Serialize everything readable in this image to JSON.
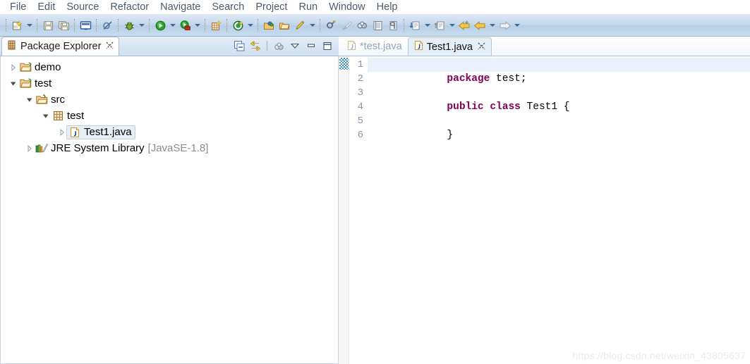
{
  "menubar": {
    "items": [
      {
        "label": "File"
      },
      {
        "label": "Edit"
      },
      {
        "label": "Source"
      },
      {
        "label": "Refactor"
      },
      {
        "label": "Navigate"
      },
      {
        "label": "Search"
      },
      {
        "label": "Project"
      },
      {
        "label": "Run"
      },
      {
        "label": "Window"
      },
      {
        "label": "Help"
      }
    ]
  },
  "toolbar": {
    "buttons": [
      {
        "name": "new-icon",
        "tooltip": "New"
      },
      {
        "name": "new-dropdown-arrow-icon",
        "tooltip": "New menu"
      },
      {
        "name": "save-icon",
        "tooltip": "Save"
      },
      {
        "name": "save-all-icon",
        "tooltip": "Save All"
      },
      {
        "name": "console-icon",
        "tooltip": "Open Console"
      },
      {
        "name": "skip-breakpoints-icon",
        "tooltip": "Skip All Breakpoints"
      },
      {
        "name": "debug-bug-icon",
        "tooltip": "Debug"
      },
      {
        "name": "debug-dropdown-arrow-icon",
        "tooltip": "Debug menu"
      },
      {
        "name": "run-play-icon",
        "tooltip": "Run"
      },
      {
        "name": "run-dropdown-arrow-icon",
        "tooltip": "Run menu"
      },
      {
        "name": "external-tools-icon",
        "tooltip": "External Tools"
      },
      {
        "name": "external-tools-dropdown-arrow-icon",
        "tooltip": "External Tools menu"
      },
      {
        "name": "new-java-project-icon",
        "tooltip": "New Java Project"
      },
      {
        "name": "new-java-class-icon",
        "tooltip": "New Java Class"
      },
      {
        "name": "new-class-dropdown-arrow-icon",
        "tooltip": "New Java Class menu"
      },
      {
        "name": "open-type-icon",
        "tooltip": "Open Type"
      },
      {
        "name": "open-task-icon",
        "tooltip": "Open Task"
      },
      {
        "name": "toggle-mark-occurrences-icon",
        "tooltip": "Toggle Mark Occurrences"
      },
      {
        "name": "mark-occurrences-dropdown-arrow-icon",
        "tooltip": "Mark Occurrences menu"
      },
      {
        "name": "new-task-icon",
        "tooltip": "New Task"
      },
      {
        "name": "clear-icon",
        "tooltip": "Clear"
      },
      {
        "name": "task-repository-icon",
        "tooltip": "Task Repositories"
      },
      {
        "name": "outline-icon",
        "tooltip": "Outline"
      },
      {
        "name": "show-whitespace-icon",
        "tooltip": "Show Whitespace Characters"
      },
      {
        "name": "pilcrow-icon",
        "tooltip": "Show Print Margin"
      },
      {
        "name": "next-annotation-icon",
        "tooltip": "Next Annotation"
      },
      {
        "name": "next-annotation-dropdown-arrow-icon",
        "tooltip": "Next Annotation menu"
      },
      {
        "name": "previous-annotation-icon",
        "tooltip": "Previous Annotation"
      },
      {
        "name": "previous-annotation-dropdown-arrow-icon",
        "tooltip": "Previous Annotation menu"
      },
      {
        "name": "back-arrow-icon",
        "tooltip": "Back"
      },
      {
        "name": "back-history-arrow-icon",
        "tooltip": "Back history"
      },
      {
        "name": "back-dropdown-arrow-icon",
        "tooltip": "Back menu"
      },
      {
        "name": "forward-arrow-icon",
        "tooltip": "Forward"
      },
      {
        "name": "forward-dropdown-arrow-icon",
        "tooltip": "Forward menu"
      }
    ]
  },
  "package_explorer": {
    "tab_label": "Package Explorer",
    "tab_icon": "package-explorer-icon",
    "close_icon": "close-icon",
    "tools": [
      {
        "name": "collapse-all-icon",
        "tooltip": "Collapse All"
      },
      {
        "name": "link-with-editor-icon",
        "tooltip": "Link with Editor"
      },
      {
        "name": "focus-on-active-task-icon",
        "tooltip": "Focus on Active Task"
      },
      {
        "name": "view-menu-icon",
        "tooltip": "View Menu"
      },
      {
        "name": "minimize-icon",
        "tooltip": "Minimize"
      },
      {
        "name": "maximize-icon",
        "tooltip": "Maximize"
      }
    ],
    "tree": [
      {
        "label": "demo",
        "suffix": "",
        "icon": "java-project-icon",
        "state": "collapsed",
        "indent": 0,
        "selected": false
      },
      {
        "label": "test",
        "suffix": "",
        "icon": "java-project-icon",
        "state": "expanded",
        "indent": 0,
        "selected": false
      },
      {
        "label": "src",
        "suffix": "",
        "icon": "source-folder-icon",
        "state": "expanded",
        "indent": 1,
        "selected": false
      },
      {
        "label": "test",
        "suffix": "",
        "icon": "package-icon",
        "state": "expanded",
        "indent": 2,
        "selected": false
      },
      {
        "label": "Test1.java",
        "suffix": "",
        "icon": "java-file-icon",
        "state": "collapsed",
        "indent": 3,
        "selected": true
      },
      {
        "label": "JRE System Library",
        "suffix": "[JavaSE-1.8]",
        "icon": "library-icon",
        "state": "collapsed",
        "indent": 1,
        "selected": false
      }
    ]
  },
  "editor": {
    "tabs": [
      {
        "label": "*test.java",
        "icon": "java-file-icon",
        "active": false,
        "dirty": true,
        "closeable": false
      },
      {
        "label": "Test1.java",
        "icon": "java-file-icon",
        "active": true,
        "dirty": false,
        "closeable": true
      }
    ],
    "close_icon": "close-icon",
    "gutter": [
      "1",
      "2",
      "3",
      "4",
      "5",
      "6"
    ],
    "current_line": 1,
    "code": [
      {
        "line": 1,
        "tokens": [
          {
            "t": "package",
            "k": true
          },
          {
            "t": " test;",
            "k": false
          }
        ]
      },
      {
        "line": 2,
        "tokens": [
          {
            "t": "",
            "k": false
          }
        ]
      },
      {
        "line": 3,
        "tokens": [
          {
            "t": "public",
            "k": true
          },
          {
            "t": " ",
            "k": false
          },
          {
            "t": "class",
            "k": true
          },
          {
            "t": " Test1 {",
            "k": false
          }
        ]
      },
      {
        "line": 4,
        "tokens": [
          {
            "t": "",
            "k": false
          }
        ]
      },
      {
        "line": 5,
        "tokens": [
          {
            "t": "}",
            "k": false
          }
        ]
      },
      {
        "line": 6,
        "tokens": [
          {
            "t": "",
            "k": false
          }
        ]
      }
    ],
    "keyword_color": "#7f0055",
    "text_color": "#000000",
    "current_line_color": "#e9f1fb"
  },
  "watermark": {
    "text": "https://blog.csdn.net/weixin_43805637"
  }
}
